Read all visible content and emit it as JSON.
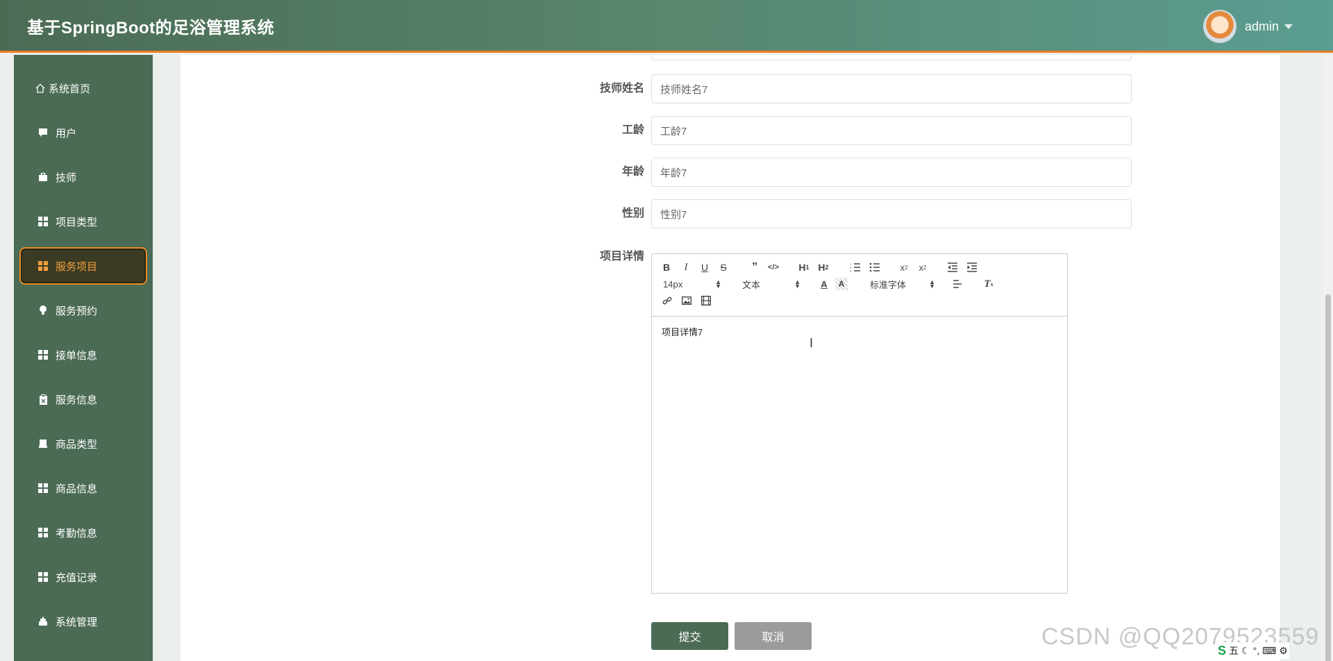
{
  "header": {
    "title": "基于SpringBoot的足浴管理系统",
    "username": "admin"
  },
  "sidebar": {
    "items": [
      {
        "label": "系统首页",
        "icon": "home-icon"
      },
      {
        "label": "用户",
        "icon": "chat-icon"
      },
      {
        "label": "技师",
        "icon": "briefcase-icon"
      },
      {
        "label": "项目类型",
        "icon": "grid-icon"
      },
      {
        "label": "服务项目",
        "icon": "grid-icon",
        "active": true
      },
      {
        "label": "服务预约",
        "icon": "bulb-icon"
      },
      {
        "label": "接单信息",
        "icon": "grid-icon"
      },
      {
        "label": "服务信息",
        "icon": "clipboard-icon"
      },
      {
        "label": "商品类型",
        "icon": "printer-icon"
      },
      {
        "label": "商品信息",
        "icon": "grid-icon"
      },
      {
        "label": "考勤信息",
        "icon": "grid-icon"
      },
      {
        "label": "充值记录",
        "icon": "grid-icon"
      },
      {
        "label": "系统管理",
        "icon": "cake-icon"
      }
    ]
  },
  "form": {
    "fields": [
      {
        "label": "技师姓名",
        "value": "技师姓名7"
      },
      {
        "label": "工龄",
        "value": "工龄7"
      },
      {
        "label": "年龄",
        "value": "年龄7"
      },
      {
        "label": "性别",
        "value": "性别7"
      }
    ],
    "editor_label": "项目详情",
    "editor": {
      "font_size": "14px",
      "block_format": "文本",
      "font_family": "标准字体",
      "content": "项目详情7"
    },
    "submit_label": "提交",
    "cancel_label": "取消"
  },
  "watermark": "CSDN @QQ2079523559",
  "ime": {
    "mode": "五",
    "logo": "S"
  },
  "colors": {
    "primary": "#4b6b55",
    "accent": "#f07c22",
    "active_text": "#f0a040"
  }
}
